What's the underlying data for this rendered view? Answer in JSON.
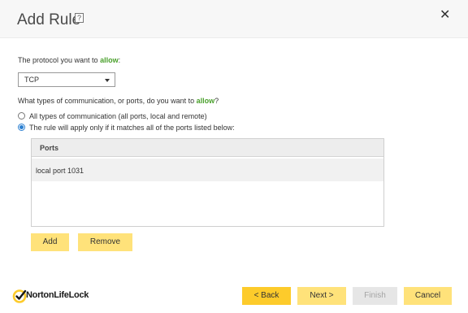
{
  "dialog": {
    "title": "Add Rule",
    "help": "?",
    "close": "✕"
  },
  "protocol": {
    "label_prefix": "The protocol you want to ",
    "label_emph": "allow",
    "label_suffix": ":",
    "selected": "TCP"
  },
  "ports_question": {
    "prefix": "What types of communication, or ports, do you want to ",
    "emph": "allow",
    "suffix": "?"
  },
  "options": [
    {
      "label": "All types of communication (all ports, local and remote)",
      "selected": false
    },
    {
      "label": "The rule will apply only if it matches all of the ports listed below:",
      "selected": true
    }
  ],
  "table": {
    "header": "Ports",
    "rows": [
      "local port 1031"
    ]
  },
  "actions": {
    "add": "Add",
    "remove": "Remove"
  },
  "footer": {
    "brand": "NortonLifeLock",
    "back": "< Back",
    "next": "Next >",
    "finish": "Finish",
    "cancel": "Cancel"
  },
  "colors": {
    "accent_green": "#4aa02c",
    "button_yellow": "#ffe27a",
    "button_gold": "#fdcb2b"
  }
}
